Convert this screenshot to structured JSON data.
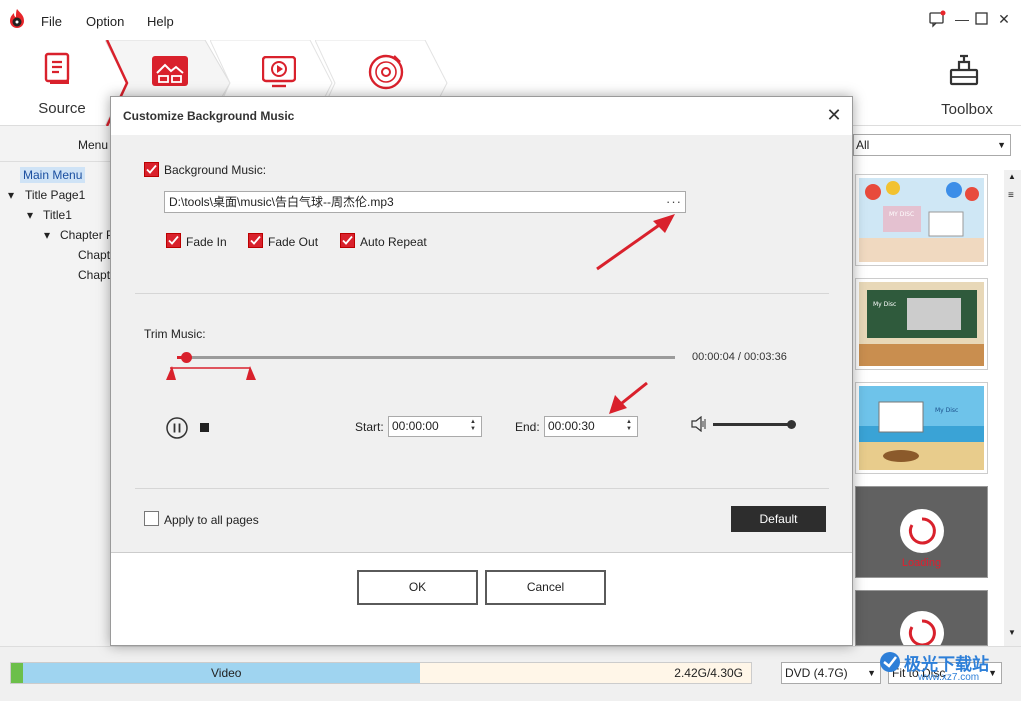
{
  "app": {
    "menu": [
      "File",
      "Option",
      "Help"
    ],
    "steps": [
      {
        "label": "Source",
        "icon": "source-icon"
      },
      {
        "label": "",
        "icon": "menu-icon"
      },
      {
        "label": "",
        "icon": "preview-icon"
      },
      {
        "label": "",
        "icon": "burn-icon"
      }
    ],
    "toolbox_label": "Toolbox",
    "left_panel": {
      "header": "Menu",
      "tree": [
        {
          "label": "Main Menu",
          "selected": true
        },
        {
          "label": "Title Page1"
        },
        {
          "label": "Title1"
        },
        {
          "label": "Chapter P"
        },
        {
          "label": "Chapt"
        },
        {
          "label": "Chapt"
        }
      ]
    },
    "right_panel": {
      "filter_value": "All",
      "loading_label": "Loading"
    },
    "thumbnail_texts": [
      "MY DISC",
      "My Disc",
      "My Disc"
    ],
    "status": {
      "video_label": "Video",
      "capacity": "2.42G/4.30G",
      "used_fraction": 0.56,
      "disc_type": "DVD (4.7G)",
      "fit_mode": "Fit to Disc"
    },
    "watermark": {
      "cn": "极光下载站",
      "url": "www.xz7.com"
    }
  },
  "dialog": {
    "title": "Customize Background Music",
    "bg_music_label": "Background Music:",
    "bg_music_checked": true,
    "file_path": "D:\\tools\\桌面\\music\\告白气球--周杰伦.mp3",
    "browse_label": "···",
    "fade_in_label": "Fade In",
    "fade_out_label": "Fade Out",
    "auto_repeat_label": "Auto Repeat",
    "fade_in_checked": true,
    "fade_out_checked": true,
    "auto_repeat_checked": true,
    "trim_label": "Trim Music:",
    "time_readout": "00:00:04 / 00:03:36",
    "playback_position": 0.0185,
    "start_label": "Start:",
    "start_value": "00:00:00",
    "end_label": "End:",
    "end_value": "00:00:30",
    "volume_level": 0.95,
    "apply_all_label": "Apply to all pages",
    "apply_all_checked": false,
    "default_label": "Default",
    "ok_label": "OK",
    "cancel_label": "Cancel",
    "accent_color": "#d9212c"
  }
}
